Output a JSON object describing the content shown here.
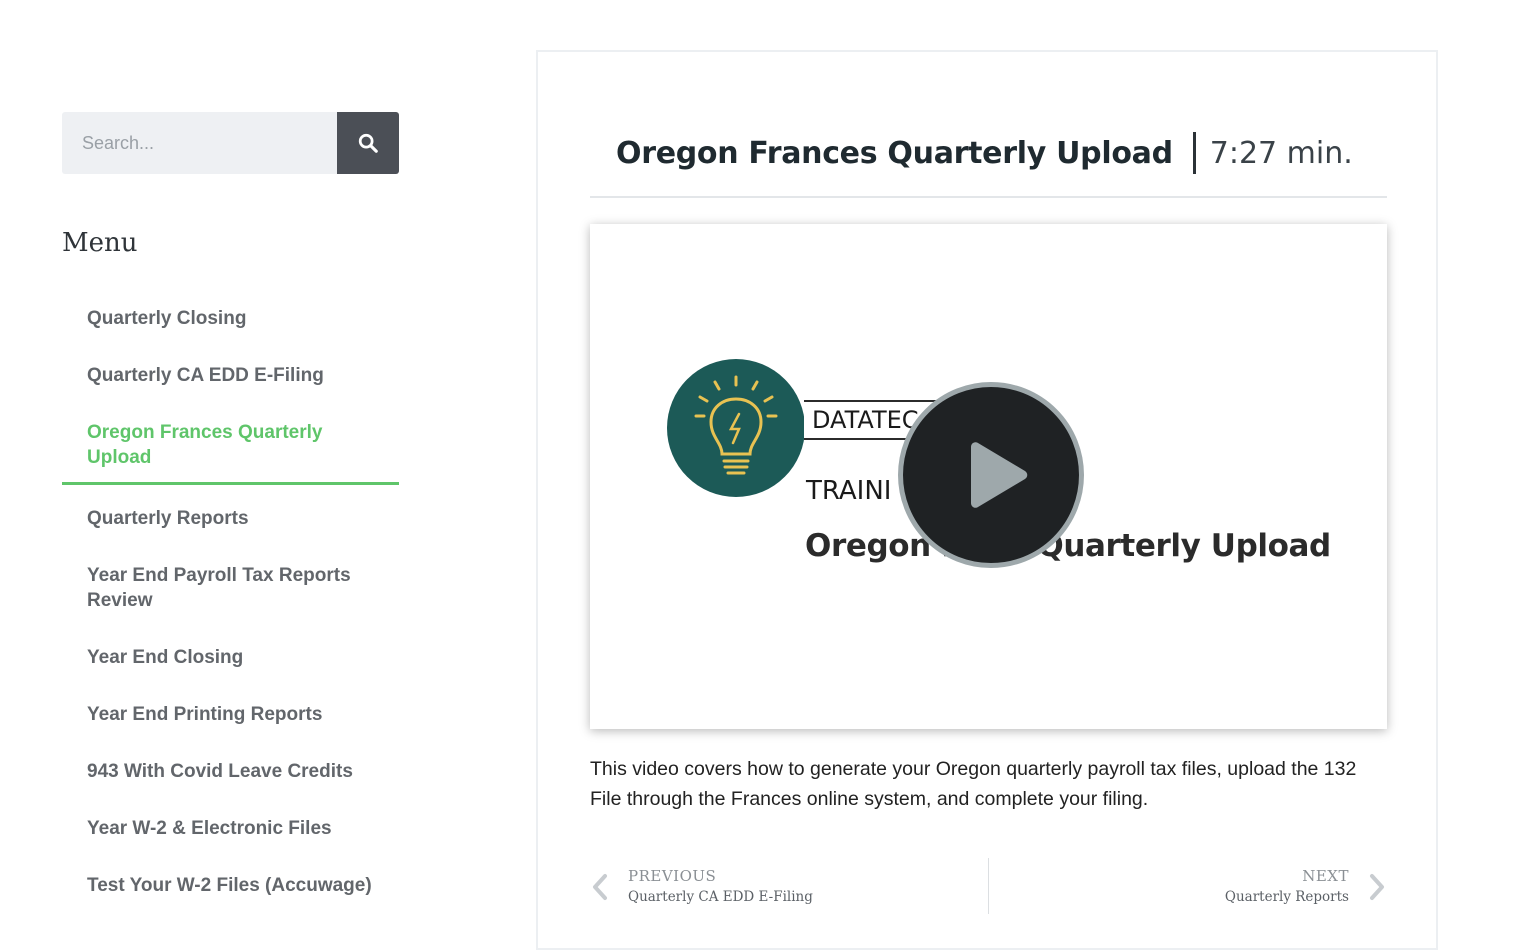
{
  "search": {
    "placeholder": "Search..."
  },
  "menu": {
    "heading": "Menu",
    "items": [
      {
        "label": "Quarterly Closing"
      },
      {
        "label": "Quarterly CA EDD E-Filing"
      },
      {
        "label": "Oregon Frances Quarterly Upload",
        "active": true
      },
      {
        "label": "Quarterly Reports"
      },
      {
        "label": "Year End Payroll Tax Reports Review"
      },
      {
        "label": "Year End Closing"
      },
      {
        "label": "Year End Printing Reports"
      },
      {
        "label": "943 With Covid Leave Credits"
      },
      {
        "label": "Year W-2 & Electronic Files"
      },
      {
        "label": "Test Your W-2 Files (Accuwage)"
      }
    ]
  },
  "article": {
    "title": "Oregon Frances Quarterly Upload",
    "duration": "7:27 min.",
    "video": {
      "brand": "DATATEC",
      "training": "TRAINI",
      "subtitle": "Oregon Fr          Quarterly Upload"
    },
    "description": "This video covers how to generate your Oregon quarterly payroll tax files, upload the 132 File through the Frances online system, and complete your filing."
  },
  "post_nav": {
    "prev": {
      "label": "PREVIOUS",
      "title": "Quarterly CA EDD E-Filing"
    },
    "next": {
      "label": "NEXT",
      "title": "Quarterly Reports"
    }
  },
  "colors": {
    "accent": "#5fc56a",
    "search_button": "#4b4f56",
    "logo_circle": "#1c5a57",
    "bulb": "#e8c252",
    "play_button": "#1f2224"
  },
  "icons": {
    "search_button": "search-icon",
    "logo": "lightbulb-icon",
    "play": "play-icon",
    "prev": "chevron-left-icon",
    "next": "chevron-right-icon"
  }
}
